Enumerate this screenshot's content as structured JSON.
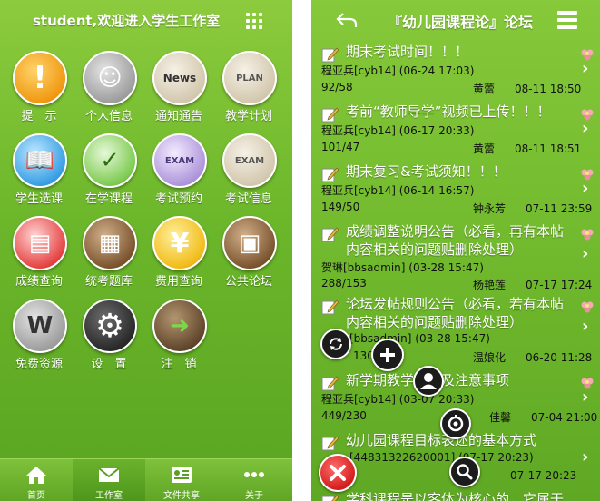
{
  "left": {
    "header_title": "student,欢迎进入学生工作室",
    "menu": [
      {
        "label": "提　示",
        "icon": "exclamation-icon",
        "glyph": "!"
      },
      {
        "label": "个人信息",
        "icon": "id-card-icon",
        "glyph": "☺"
      },
      {
        "label": "通知通告",
        "icon": "news-board-icon",
        "glyph": "News"
      },
      {
        "label": "教学计划",
        "icon": "plan-notebook-icon",
        "glyph": "PLAN"
      },
      {
        "label": "学生选课",
        "icon": "open-book-icon",
        "glyph": "📖"
      },
      {
        "label": "在学课程",
        "icon": "checklist-icon",
        "glyph": "✓"
      },
      {
        "label": "考试预约",
        "icon": "exam-clock-icon",
        "glyph": "EXAM"
      },
      {
        "label": "考试信息",
        "icon": "exam-search-icon",
        "glyph": "EXAM"
      },
      {
        "label": "成绩查询",
        "icon": "grade-report-icon",
        "glyph": "▤"
      },
      {
        "label": "统考题库",
        "icon": "question-bank-icon",
        "glyph": "▦"
      },
      {
        "label": "费用查询",
        "icon": "yuan-coin-icon",
        "glyph": "¥"
      },
      {
        "label": "公共论坛",
        "icon": "forum-books-icon",
        "glyph": "▣"
      },
      {
        "label": "免费资源",
        "icon": "wikipedia-globe-icon",
        "glyph": "W"
      },
      {
        "label": "设　置",
        "icon": "settings-gear-icon",
        "glyph": "⚙"
      },
      {
        "label": "注　销",
        "icon": "logout-door-icon",
        "glyph": "➜"
      }
    ],
    "tabs": [
      {
        "label": "首页",
        "icon": "home-icon"
      },
      {
        "label": "工作室",
        "icon": "mail-icon"
      },
      {
        "label": "文件共享",
        "icon": "id-folder-icon"
      },
      {
        "label": "关于",
        "icon": "more-dots-icon"
      }
    ]
  },
  "right": {
    "header_title": "『幼儿园课程论』论坛",
    "posts": [
      {
        "title": "期末考试时间！！！",
        "author": "程亚兵[cyb14] (06-24 17:03)",
        "counts": "92/58",
        "last_user": "黄蕾",
        "last_time": "08-11 18:50",
        "flag": true
      },
      {
        "title": "考前“教师导学”视频已上传！！！",
        "author": "程亚兵[cyb14] (06-17 20:33)",
        "counts": "101/47",
        "last_user": "黄蕾",
        "last_time": "08-11 18:51",
        "flag": true
      },
      {
        "title": "期末复习&考试须知！！！",
        "author": "程亚兵[cyb14] (06-14 16:57)",
        "counts": "149/50",
        "last_user": "钟永芳",
        "last_time": "07-11 23:59",
        "flag": true
      },
      {
        "title": "成绩调整说明公告（必看，再有本帖内容相关的问题贴删除处理）",
        "author": "贺琳[bbsadmin] (03-28 15:47)",
        "counts": "288/153",
        "last_user": "杨艳莲",
        "last_time": "07-17 17:24",
        "flag": true
      },
      {
        "title": "论坛发帖规则公告（必看，若有本帖内容相关的问题贴删除处理）",
        "author": "[bbsadmin] (03-28 15:47)",
        "counts": "130/72",
        "last_user": "温娘化",
        "last_time": "06-20 11:28",
        "flag": true
      },
      {
        "title": "新学期教学　　及注意事项",
        "author": "程亚兵[cyb14] (03-07 20:33)",
        "counts": "449/230",
        "last_user": "佳馨",
        "last_time": "07-04 21:00",
        "flag": true
      },
      {
        "title": "幼儿园课程目标表述的基本方式",
        "author": "[44831322620001] (07-17 20:23)",
        "counts": "",
        "last_user": "---",
        "last_time": "07-17 20:23",
        "flag": false
      },
      {
        "title": "学科课程是以客体为核心的，它属于",
        "author": "",
        "counts": "",
        "last_user": "",
        "last_time": "",
        "flag": false
      }
    ],
    "fabs": [
      {
        "name": "refresh-icon"
      },
      {
        "name": "add-icon"
      },
      {
        "name": "user-icon"
      },
      {
        "name": "target-icon"
      },
      {
        "name": "close-icon"
      },
      {
        "name": "search-icon"
      }
    ]
  }
}
